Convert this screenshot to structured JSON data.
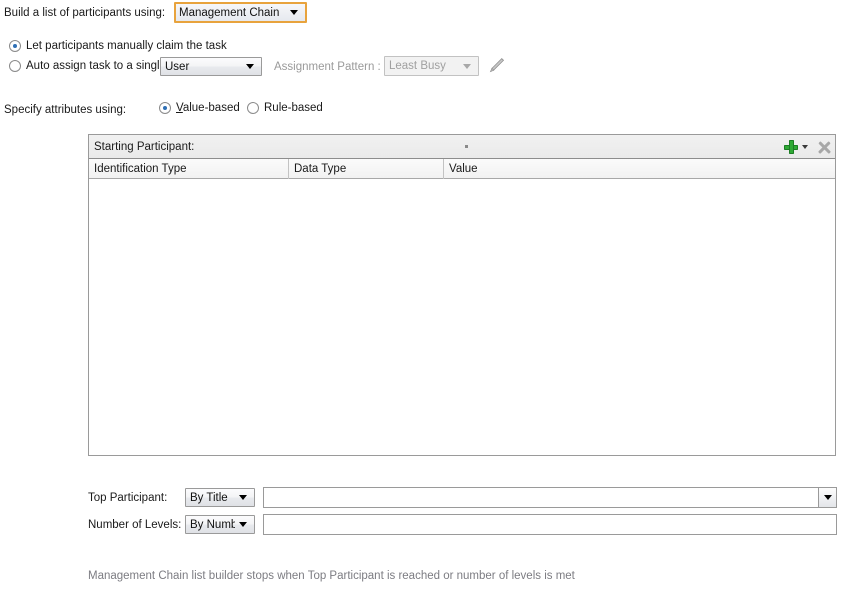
{
  "build_list": {
    "label": "Build a list of participants using:",
    "selected": "Management Chain"
  },
  "assignment": {
    "manual_radio_label": "Let participants manually claim the task",
    "manual_radio_checked": true,
    "auto_radio_label": "Auto assign task to a single",
    "auto_radio_checked": false,
    "auto_target": "User",
    "pattern_label": "Assignment Pattern :",
    "pattern_value": "Least Busy",
    "pattern_disabled": true,
    "edit_icon": "pencil-icon"
  },
  "attributes": {
    "label": "Specify attributes using:",
    "value_based_label": "Value-based",
    "value_based_mnemonic": "V",
    "value_based_rest": "alue-based",
    "value_based_checked": true,
    "rule_based_label": "Rule-based",
    "rule_based_checked": false
  },
  "participant_table": {
    "title": "Starting Participant:",
    "add_icon": "add-plus-icon",
    "add_dropdown_icon": "chevron-down-icon",
    "delete_icon": "delete-x-icon",
    "columns": [
      "Identification Type",
      "Data Type",
      "Value"
    ],
    "rows": []
  },
  "top_participant": {
    "label": "Top Participant:",
    "mode": "By Title",
    "value": "",
    "dropdown_icon": "chevron-down-icon"
  },
  "number_of_levels": {
    "label": "Number of Levels:",
    "mode": "By Number",
    "value": ""
  },
  "footer": {
    "note": "Management Chain list builder stops when Top Participant is reached or number of levels is met"
  },
  "colors": {
    "focus_border": "#e8a33d",
    "radio_dot": "#2f6fb5",
    "add_icon_green": "#2faa35",
    "disabled_text": "#9a9a9a",
    "note_text": "#7c7c82"
  }
}
